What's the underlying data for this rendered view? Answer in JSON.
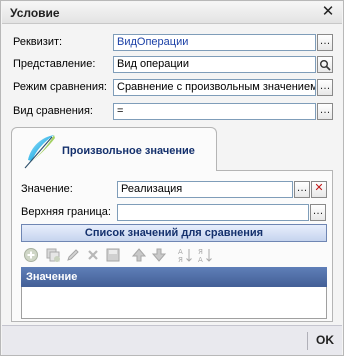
{
  "window": {
    "title": "Условие",
    "close_glyph": "✕"
  },
  "fields": {
    "requisite": {
      "label": "Реквизит:",
      "value": "ВидОперации"
    },
    "presentation": {
      "label": "Представление:",
      "value": "Вид операции"
    },
    "compare_mode": {
      "label": "Режим сравнения:",
      "value": "Сравнение с произвольным значением"
    },
    "compare_type": {
      "label": "Вид сравнения:",
      "value": "="
    }
  },
  "tab": {
    "label": "Произвольное значение"
  },
  "tab_fields": {
    "value": {
      "label": "Значение:",
      "value": "Реализация"
    },
    "upper_bound": {
      "label": "Верхняя граница:",
      "value": ""
    }
  },
  "list_button": {
    "label": "Список значений для сравнения"
  },
  "grid": {
    "column_header": "Значение"
  },
  "footer": {
    "ok_label": "OK"
  },
  "colors": {
    "accent": "#15316d",
    "grid_header": "#4f6ea7",
    "field_border": "#7f9db9"
  }
}
